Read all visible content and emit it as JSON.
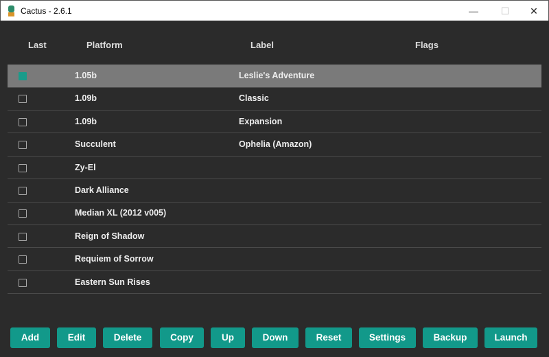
{
  "window": {
    "title": "Cactus - 2.6.1",
    "minimize": "—",
    "maximize": "☐",
    "close": "✕"
  },
  "columns": [
    "Last",
    "Platform",
    "Label",
    "Flags"
  ],
  "rows": [
    {
      "checked": true,
      "platform": "1.05b",
      "label": "Leslie's Adventure",
      "flags": ""
    },
    {
      "checked": false,
      "platform": "1.09b",
      "label": "Classic",
      "flags": ""
    },
    {
      "checked": false,
      "platform": "1.09b",
      "label": "Expansion",
      "flags": ""
    },
    {
      "checked": false,
      "platform": "Succulent",
      "label": "Ophelia (Amazon)",
      "flags": ""
    },
    {
      "checked": false,
      "platform": "Zy-El",
      "label": "",
      "flags": ""
    },
    {
      "checked": false,
      "platform": "Dark Alliance",
      "label": "",
      "flags": ""
    },
    {
      "checked": false,
      "platform": "Median XL (2012 v005)",
      "label": "",
      "flags": ""
    },
    {
      "checked": false,
      "platform": "Reign of Shadow",
      "label": "",
      "flags": ""
    },
    {
      "checked": false,
      "platform": "Requiem of Sorrow",
      "label": "",
      "flags": ""
    },
    {
      "checked": false,
      "platform": "Eastern Sun Rises",
      "label": "",
      "flags": ""
    }
  ],
  "buttons": [
    "Add",
    "Edit",
    "Delete",
    "Copy",
    "Up",
    "Down",
    "Reset",
    "Settings",
    "Backup",
    "Launch"
  ],
  "colors": {
    "accent": "#12998a",
    "selected_row": "#7a7a7a",
    "background": "#2b2b2b"
  }
}
